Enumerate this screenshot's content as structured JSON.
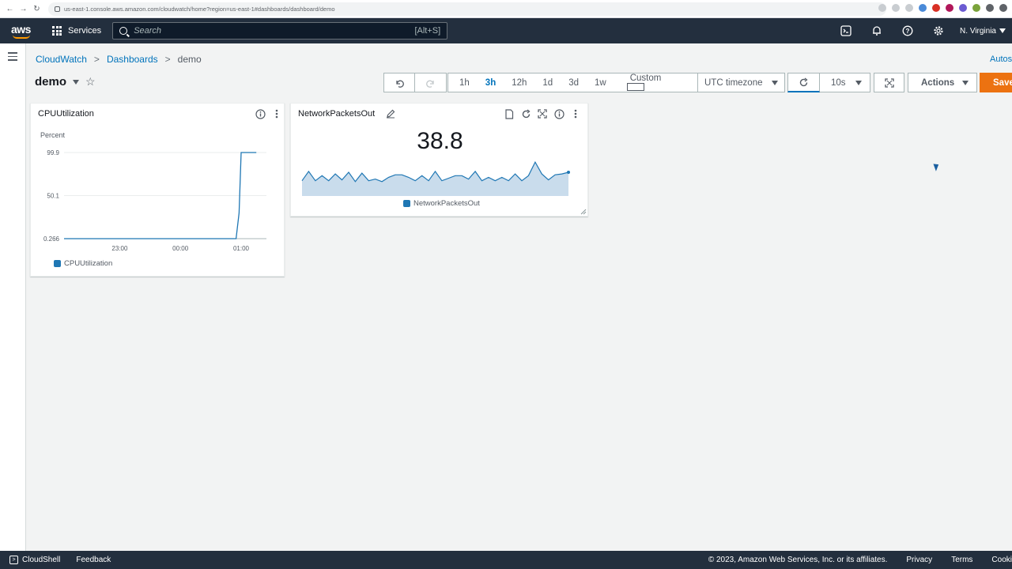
{
  "browser": {
    "url": "us-east-1.console.aws.amazon.com/cloudwatch/home?region=us-east-1#dashboards/dashboard/demo"
  },
  "topnav": {
    "logo": "aws",
    "services_label": "Services",
    "search_placeholder": "Search",
    "search_shortcut": "[Alt+S]",
    "region": "N. Virginia"
  },
  "breadcrumb": {
    "items": [
      "CloudWatch",
      "Dashboards",
      "demo"
    ],
    "sep": ">"
  },
  "autosave_label": "Autos",
  "dashboard": {
    "title": "demo"
  },
  "toolbar": {
    "ranges": [
      "1h",
      "3h",
      "12h",
      "1d",
      "3d",
      "1w",
      "Custom"
    ],
    "active_range": "3h",
    "timezone": "UTC timezone",
    "refresh_interval": "10s",
    "actions_label": "Actions",
    "save_label": "Save"
  },
  "widgets": {
    "cpu": {
      "title": "CPUUtilization",
      "ylabel": "Percent",
      "legend": "CPUUtilization"
    },
    "net": {
      "title": "NetworkPacketsOut",
      "value": "38.8",
      "legend": "NetworkPacketsOut"
    }
  },
  "chart_data": [
    {
      "type": "line",
      "title": "CPUUtilization",
      "ylabel": "Percent",
      "y_ticks": [
        "99.9",
        "50.1",
        "0.266"
      ],
      "x_ticks": [
        "23:00",
        "00:00",
        "01:00"
      ],
      "x": [
        "22:05",
        "22:30",
        "23:00",
        "23:30",
        "00:00",
        "00:30",
        "00:50",
        "00:55",
        "00:58",
        "01:00",
        "01:05",
        "01:15"
      ],
      "series": [
        {
          "name": "CPUUtilization",
          "values": [
            0.266,
            0.266,
            0.266,
            0.266,
            0.266,
            0.266,
            0.266,
            0.266,
            30,
            99.9,
            99.9,
            99.9
          ]
        }
      ],
      "ylim": [
        0.266,
        99.9
      ],
      "legend": "bottom-left",
      "color": "#1f77b4"
    },
    {
      "type": "area",
      "title": "NetworkPacketsOut",
      "series": [
        {
          "name": "NetworkPacketsOut",
          "values": [
            38,
            49,
            38,
            44,
            38,
            46,
            39,
            48,
            37,
            47,
            38,
            40,
            37,
            42,
            45,
            45,
            42,
            38,
            44,
            38,
            49,
            38,
            41,
            44,
            44,
            40,
            49,
            38,
            42,
            38,
            42,
            38,
            46,
            38,
            44,
            60,
            46,
            39,
            45,
            46,
            48
          ]
        }
      ],
      "latest_value": 38.8,
      "legend": "bottom-center",
      "color": "#1f77b4",
      "fill": "#c9dcec"
    }
  ],
  "footer": {
    "cloudshell": "CloudShell",
    "feedback": "Feedback",
    "copyright": "© 2023, Amazon Web Services, Inc. or its affiliates.",
    "privacy": "Privacy",
    "terms": "Terms",
    "cookies": "Cooki"
  },
  "colors": {
    "nav_bg": "#232f3e",
    "link": "#0073bb",
    "save_orange": "#ec7211",
    "series": "#1f77b4"
  }
}
